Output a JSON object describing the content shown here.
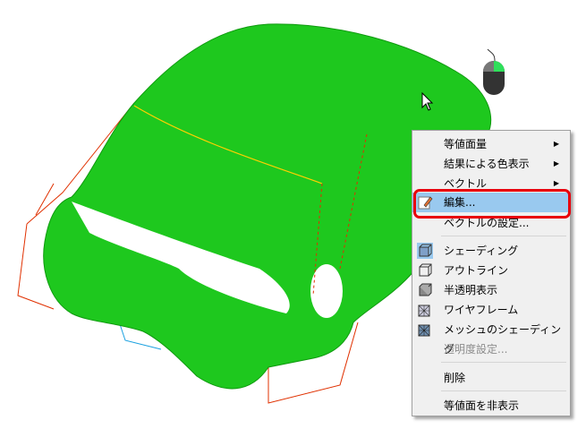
{
  "menu": {
    "items": [
      {
        "label": "等値面量",
        "submenu": true
      },
      {
        "label": "結果による色表示",
        "submenu": true
      },
      {
        "label": "ベクトル",
        "submenu": true
      },
      {
        "label": "編集...",
        "highlighted": true
      },
      {
        "label": "ベクトルの設定..."
      },
      {
        "label": "シェーディング",
        "checked": true
      },
      {
        "label": "アウトライン"
      },
      {
        "label": "半透明表示"
      },
      {
        "label": "ワイヤフレーム"
      },
      {
        "label": "メッシュのシェーディング"
      },
      {
        "label": "透明度設定...",
        "disabled": true
      },
      {
        "label": "削除"
      },
      {
        "label": "等値面を非表示"
      }
    ]
  },
  "colors": {
    "surface": "#1ec81e",
    "highlight": "#99c9ef",
    "callout": "#e8000b"
  }
}
